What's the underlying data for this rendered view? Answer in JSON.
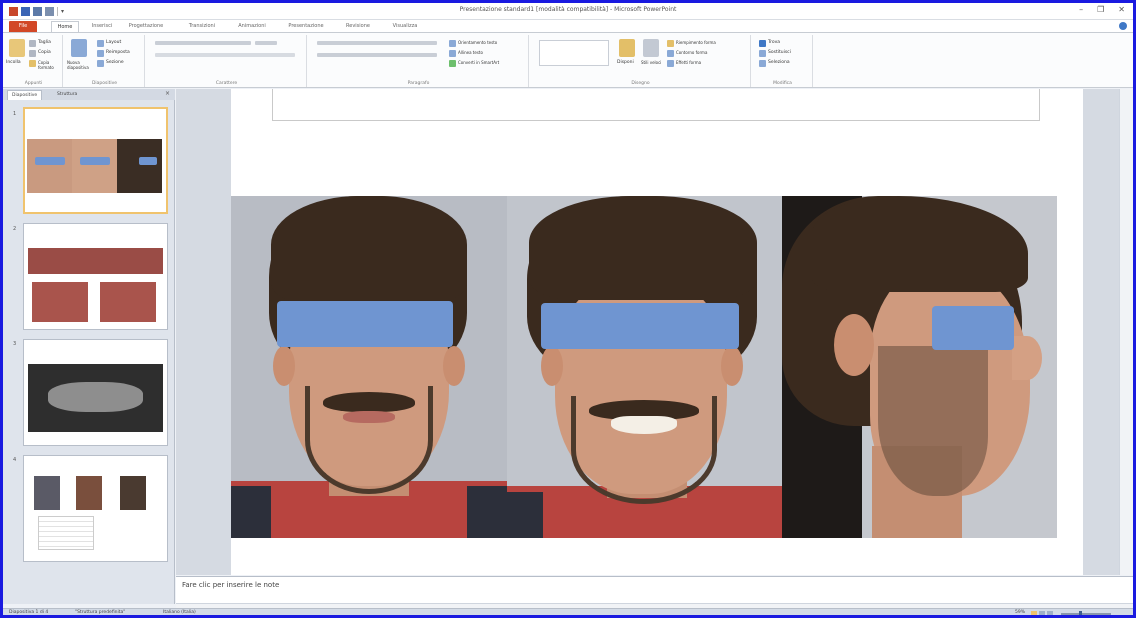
{
  "window": {
    "title": "Presentazione standard1 [modalità compatibilità] - Microsoft PowerPoint",
    "minimize": "–",
    "maximize": "❐",
    "close": "✕"
  },
  "ribbon_tabs": [
    {
      "label": "File"
    },
    {
      "label": "Home"
    },
    {
      "label": "Inserisci"
    },
    {
      "label": "Progettazione"
    },
    {
      "label": "Transizioni"
    },
    {
      "label": "Animazioni"
    },
    {
      "label": "Presentazione"
    },
    {
      "label": "Revisione"
    },
    {
      "label": "Visualizza"
    }
  ],
  "ribbon": {
    "clipboard": {
      "paste": "Incolla",
      "cut": "Taglia",
      "copy": "Copia",
      "format_painter": "Copia formato",
      "group": "Appunti"
    },
    "slides": {
      "new_slide": "Nuova diapositiva",
      "layout": "Layout",
      "reset": "Reimposta",
      "section": "Sezione",
      "group": "Diapositive"
    },
    "font": {
      "group": "Carattere"
    },
    "paragraph": {
      "group": "Paragrafo",
      "text_direction": "Orientamento testo",
      "align_text": "Allinea testo",
      "smartart": "Converti in SmartArt"
    },
    "drawing": {
      "arrange": "Disponi",
      "quick_styles": "Stili veloci",
      "shape_fill": "Riempimento forma",
      "shape_outline": "Contorno forma",
      "shape_effects": "Effetti forma",
      "group": "Disegno"
    },
    "editing": {
      "find": "Trova",
      "replace": "Sostituisci",
      "select": "Seleziona",
      "group": "Modifica"
    }
  },
  "pane": {
    "tabs": [
      "Diapositive",
      "Struttura"
    ],
    "close": "×",
    "thumbnails": [
      {
        "number": "1"
      },
      {
        "number": "2"
      },
      {
        "number": "3"
      },
      {
        "number": "4"
      }
    ]
  },
  "notes": {
    "placeholder": "Fare clic per inserire le note"
  },
  "status": {
    "slide_info": "Diapositiva 1 di 4",
    "theme": "\"Struttura predefinita\"",
    "language": "Italiano (Italia)",
    "zoom": "59%"
  },
  "colors": {
    "accent_file": "#d24726",
    "eye_bar": "#6f95d1",
    "frame": "#1a1ae0"
  }
}
